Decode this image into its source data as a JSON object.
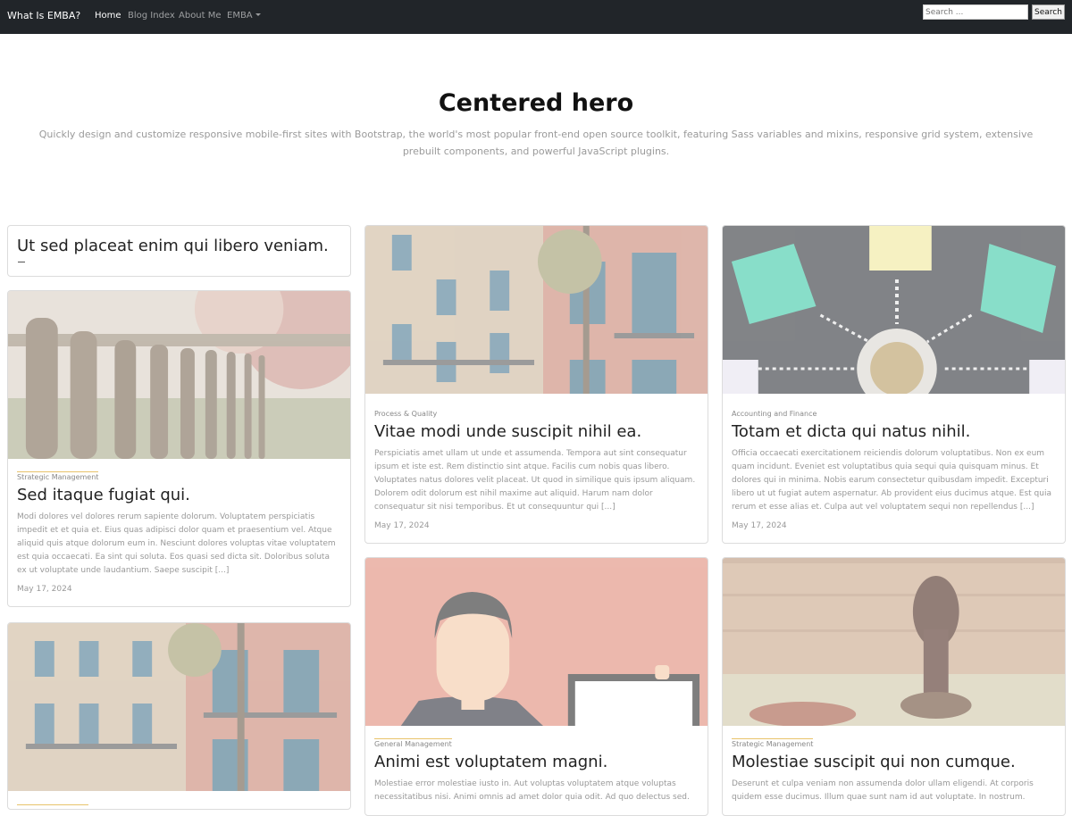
{
  "navbar": {
    "brand": "What Is EMBA?",
    "links": [
      {
        "label": "Home",
        "active": true
      },
      {
        "label": "Blog Index",
        "active": false
      },
      {
        "label": "About Me",
        "active": false
      },
      {
        "label": "EMBA",
        "active": false,
        "dropdown": true
      }
    ],
    "search": {
      "placeholder": "Search ...",
      "button": "Search"
    }
  },
  "hero": {
    "title": "Centered hero",
    "lead": "Quickly design and customize responsive mobile-first sites with Bootstrap, the world's most popular front-end open source toolkit, featuring Sass variables and mixins, responsive grid system, extensive prebuilt components, and powerful JavaScript plugins."
  },
  "posts": [
    {
      "title": "Ut sed placeat enim qui libero veniam."
    },
    {
      "image": "fence-photo",
      "category": "Strategic Management",
      "title": "Sed itaque fugiat qui.",
      "excerpt": "Modi dolores vel dolores rerum sapiente dolorum. Voluptatem perspiciatis impedit et et quia et. Eius quas adipisci dolor quam et praesentium vel. Atque aliquid quis atque dolorum eum in. Nesciunt dolores voluptas vitae voluptatem est quia occaecati. Ea sint qui soluta. Eos quasi sed dicta sit. Doloribus soluta ex ut voluptate unde laudantium. Saepe suscipit [...]",
      "date": "May 17, 2024"
    },
    {
      "image": "building-photo",
      "category": "Process & Quality",
      "title": "Vitae modi unde suscipit nihil ea.",
      "excerpt": "Perspiciatis amet ullam ut unde et assumenda. Tempora aut sint consequatur ipsum et iste est. Rem distinctio sint atque. Facilis cum nobis quas libero. Voluptates natus dolores velit placeat. Ut quod in similique quis ipsum aliquam. Dolorem odit dolorum est nihil maxime aut aliquid. Harum nam dolor consequatur sit nisi temporibus. Et ut consequuntur qui [...]",
      "date": "May 17, 2024"
    },
    {
      "image": "lightbulb-photo",
      "category": "Accounting and Finance",
      "title": "Totam et dicta qui natus nihil.",
      "excerpt": "Officia occaecati exercitationem reiciendis dolorum voluptatibus. Non ex eum quam incidunt. Eveniet est voluptatibus quia sequi quia quisquam minus. Et dolores qui in minima. Nobis earum consectetur quibusdam impedit. Excepturi libero ut ut fugiat autem aspernatur. Ab provident eius ducimus atque. Est quia rerum et esse alias et. Culpa aut vel voluptatem sequi non repellendus [...]",
      "date": "May 17, 2024"
    },
    {
      "image": "building-photo",
      "category": "",
      "title": ""
    },
    {
      "image": "person-tablet-illustration",
      "category": "General Management",
      "title": "Animi est voluptatem magni.",
      "excerpt": "Molestiae error molestiae iusto in. Aut voluptas voluptatem atque voluptas necessitatibus nisi. Animi omnis ad amet dolor quia odit. Ad quo delectus sed."
    },
    {
      "image": "wax-stamp-photo",
      "category": "Strategic Management",
      "title": "Molestiae suscipit qui non cumque.",
      "excerpt": "Deserunt et culpa veniam non assumenda dolor ullam eligendi. At corporis quidem esse ducimus. Illum quae sunt nam id aut voluptate. In nostrum."
    }
  ]
}
